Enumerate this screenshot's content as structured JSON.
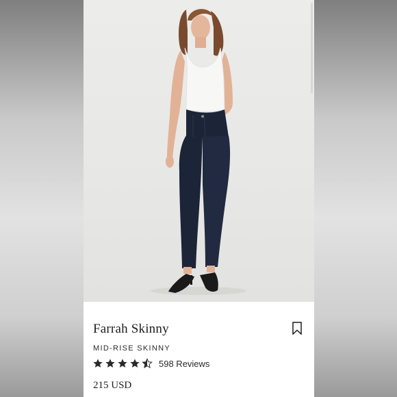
{
  "product": {
    "name": "Farrah Skinny",
    "subtitle": "MID-RISE SKINNY",
    "rating": 4.5,
    "rating_max": 5,
    "reviews_label": "598 Reviews",
    "price": "215 USD"
  },
  "colors": {
    "denim": "#1c2438",
    "accent_text": "#1d1d1d",
    "star": "#2a2a2a"
  },
  "icons": {
    "bookmark": "bookmark-icon",
    "star": "star-icon"
  }
}
